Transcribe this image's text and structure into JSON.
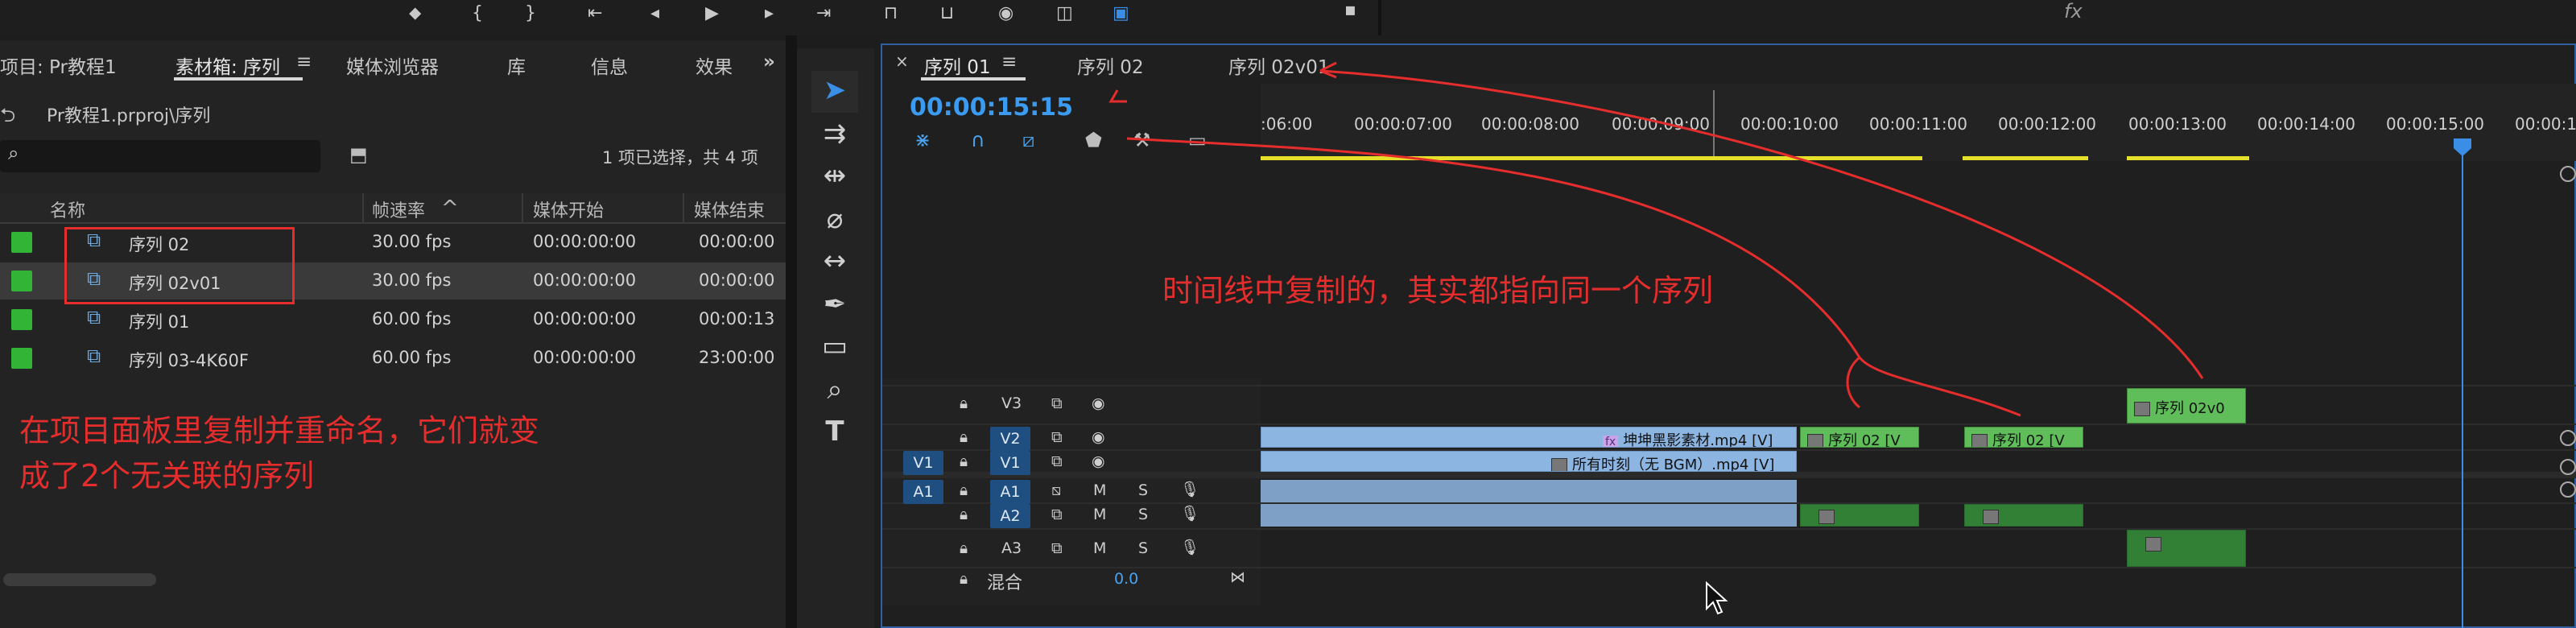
{
  "top_toolbar": {
    "icons": [
      "marker-icon",
      "in-point-icon",
      "out-point-icon",
      "go-to-in-icon",
      "step-back-icon",
      "play-icon",
      "step-forward-icon",
      "go-to-out-icon",
      "insert-icon",
      "overwrite-icon",
      "export-frame-icon",
      "compare-icon",
      "button-editor-icon"
    ],
    "fx_label": "fx"
  },
  "project_panel": {
    "tabs": [
      "项目: Pr教程1",
      "素材箱: 序列",
      "媒体浏览器",
      "库",
      "信息",
      "效果"
    ],
    "active_tab_menu": "≡",
    "overflow": "»",
    "path": "Pr教程1.prproj\\序列",
    "search_placeholder": "",
    "selection_status": "1 项已选择，共 4 项",
    "columns": [
      "名称",
      "帧速率",
      "媒体开始",
      "媒体结束"
    ],
    "sort_indicator": "^",
    "rows": [
      {
        "name": "序列 02",
        "fps": "30.00 fps",
        "start": "00:00:00:00",
        "end": "00:00:00",
        "selected": false
      },
      {
        "name": "序列 02v01",
        "fps": "30.00 fps",
        "start": "00:00:00:00",
        "end": "00:00:00",
        "selected": true
      },
      {
        "name": "序列 01",
        "fps": "60.00 fps",
        "start": "00:00:00:00",
        "end": "00:00:13",
        "selected": false
      },
      {
        "name": "序列 03-4K60F",
        "fps": "60.00 fps",
        "start": "00:00:00:00",
        "end": "23:00:00",
        "selected": false
      }
    ],
    "swatch_color": "#32b437"
  },
  "tools": [
    "selection-tool-icon",
    "track-select-icon",
    "ripple-edit-icon",
    "razor-icon",
    "slip-icon",
    "pen-icon",
    "rectangle-icon",
    "hand-zoom-icon",
    "type-icon"
  ],
  "timeline": {
    "close": "×",
    "tabs": [
      "序列 01",
      "序列 02",
      "序列 02v01"
    ],
    "tab_menu": "≡",
    "timecode": "00:00:15:15",
    "ruler_labels": [
      ":06:00",
      "00:00:07:00",
      "00:00:08:00",
      "00:00:09:00",
      "00:00:10:00",
      "00:00:11:00",
      "00:00:12:00",
      "00:00:13:00",
      "00:00:14:00",
      "00:00:15:00",
      "00:00:1"
    ],
    "tracks": {
      "V3": "V3",
      "V2": "V2",
      "V1": "V1",
      "A1": "A1",
      "A2": "A2",
      "A3": "A3",
      "src_v1": "V1",
      "src_a1": "A1",
      "mute": "M",
      "solo": "S"
    },
    "mix_label": "混合",
    "mix_value": "0.0",
    "clips": {
      "v2_main": "坤坤黑影素材.mp4 [V]",
      "v1_main": "所有时刻（无 BGM）.mp4 [V]",
      "v2_seq_a": "序列 02 [V",
      "v2_seq_b": "序列 02 [V",
      "v3_seq": "序列 02v0",
      "fx_badge": "fx"
    },
    "playhead_color": "#3a8ee6",
    "work_area_color": "#e5e02a"
  },
  "annotations": {
    "timeline_note": "时间线中复制的，其实都指向同一个序列",
    "project_note_line1": "在项目面板里复制并重命名，它们就变",
    "project_note_line2": "成了2个无关联的序列",
    "color": "#e62d2d"
  }
}
